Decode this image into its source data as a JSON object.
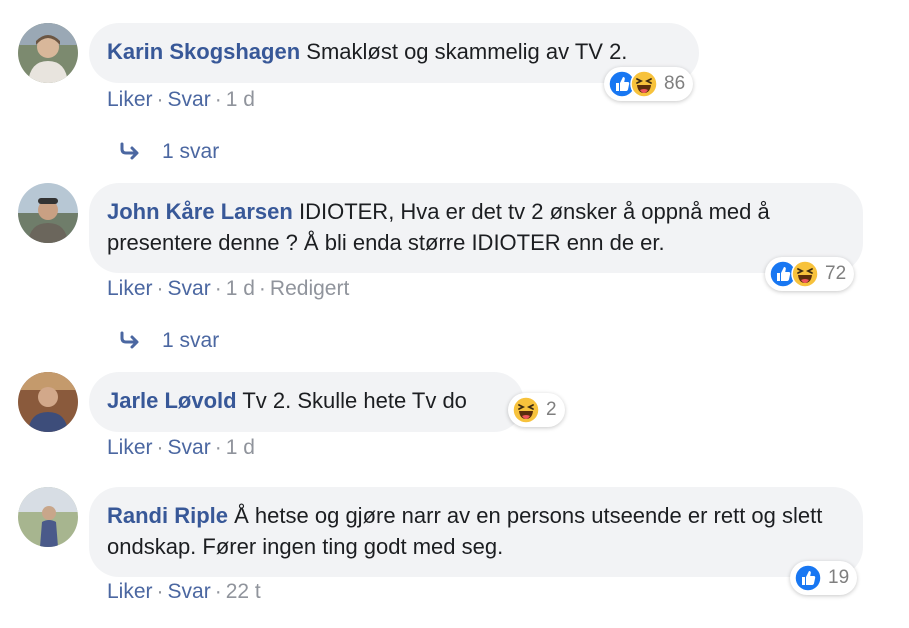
{
  "comments": [
    {
      "author": "Karin Skogshagen",
      "text": "Smakløst og skammelig av TV 2.",
      "actions": {
        "like": "Liker",
        "reply": "Svar",
        "time": "1 d"
      },
      "reactions": {
        "icons": [
          "like-icon",
          "haha-icon"
        ],
        "count": "86"
      },
      "replies": "1 svar"
    },
    {
      "author": "John Kåre Larsen",
      "text": "IDIOTER, Hva er det tv 2 ønsker å oppnå med å presentere denne ? Å bli enda større IDIOTER enn de er.",
      "actions": {
        "like": "Liker",
        "reply": "Svar",
        "time": "1 d",
        "edited": "Redigert"
      },
      "reactions": {
        "icons": [
          "like-icon",
          "haha-icon"
        ],
        "count": "72"
      },
      "replies": "1 svar"
    },
    {
      "author": "Jarle Løvold",
      "text": "Tv 2. Skulle hete Tv do",
      "actions": {
        "like": "Liker",
        "reply": "Svar",
        "time": "1 d"
      },
      "reactions": {
        "icons": [
          "haha-icon"
        ],
        "count": "2"
      }
    },
    {
      "author": "Randi Riple",
      "text": "Å hetse og gjøre narr av en persons utseende er rett og slett ondskap. Fører ingen ting godt med seg.",
      "actions": {
        "like": "Liker",
        "reply": "Svar",
        "time": "22 t"
      },
      "reactions": {
        "icons": [
          "like-icon"
        ],
        "count": "19"
      }
    }
  ],
  "colors": {
    "author": "#385898",
    "bubble": "#f2f3f5",
    "action_link": "#4b67a1",
    "meta": "#90949c",
    "like_blue": "#1877f2",
    "haha_yellow": "#f7c23c"
  }
}
